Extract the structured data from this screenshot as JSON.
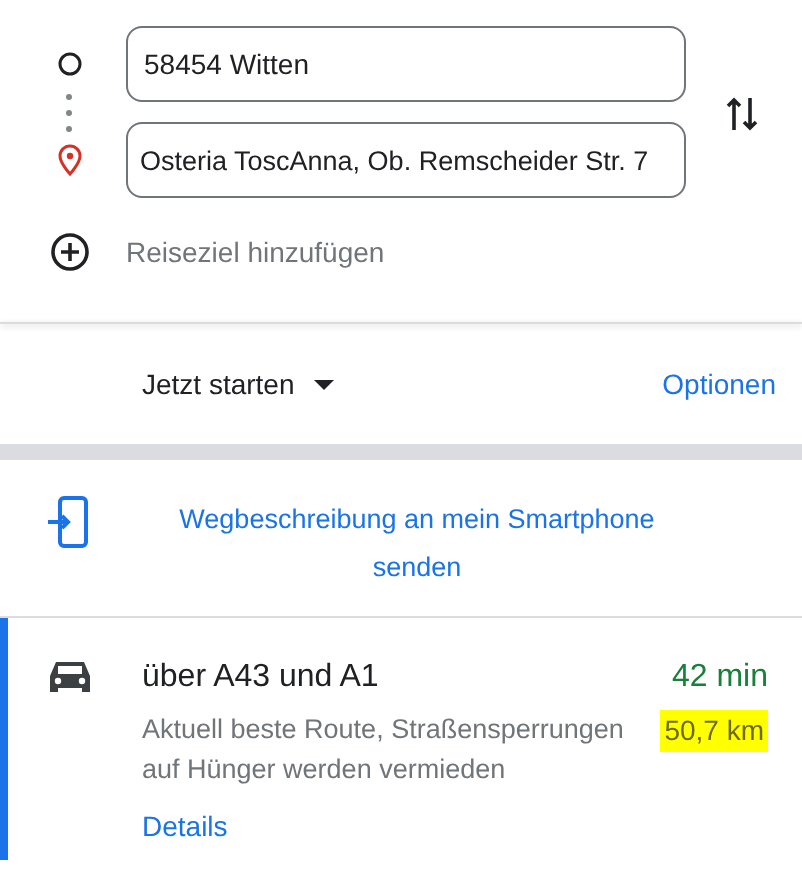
{
  "waypoints": [
    {
      "kind": "start",
      "value": "58454 Witten"
    },
    {
      "kind": "destination",
      "value": "Osteria ToscAnna, Ob. Remscheider Str. 7"
    }
  ],
  "add_destination": "Reiseziel hinzufügen",
  "depart": {
    "label": "Jetzt starten",
    "options": "Optionen"
  },
  "send_to_phone": "Wegbeschreibung an mein Smartphone senden",
  "route": {
    "selected": true,
    "title": "über A43 und A1",
    "duration": "42 min",
    "description": "Aktuell beste Route, Straßensperrungen auf Hünger werden vermieden",
    "distance": "50,7 km",
    "distance_highlighted": true,
    "details": "Details"
  }
}
